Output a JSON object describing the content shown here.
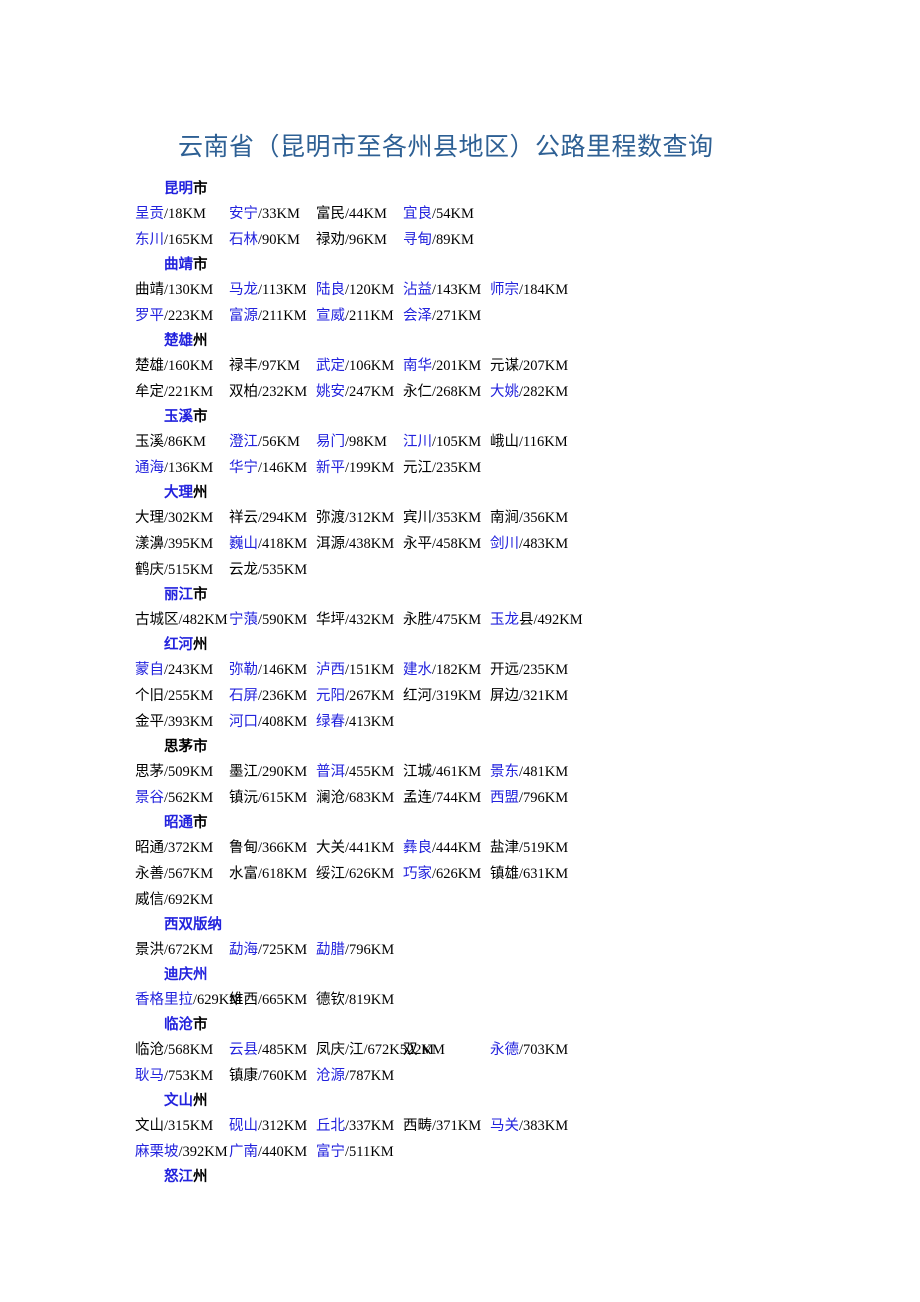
{
  "title": "云南省（昆明市至各州县地区）公路里程数查询",
  "colors": {
    "title": "#2e6094",
    "link_blue": "#2222dd",
    "text_black": "#000000",
    "background": "#ffffff"
  },
  "sections": [
    {
      "header": {
        "blue": "昆明",
        "black": "市"
      },
      "rows": [
        [
          {
            "name": "呈贡",
            "color": "blue",
            "dist": "18KM"
          },
          {
            "name": "安宁",
            "color": "blue",
            "dist": "33KM"
          },
          {
            "name": "富民",
            "color": "black",
            "dist": "44KM"
          },
          {
            "name": "宜良",
            "color": "blue",
            "dist": "54KM"
          }
        ],
        [
          {
            "name": "东川",
            "color": "blue",
            "dist": "165KM"
          },
          {
            "name": "石林",
            "color": "blue",
            "dist": "90KM"
          },
          {
            "name": "禄劝",
            "color": "black",
            "dist": "96KM"
          },
          {
            "name": "寻甸",
            "color": "blue",
            "dist": "89KM"
          }
        ]
      ]
    },
    {
      "header": {
        "blue": "曲靖",
        "black": "市"
      },
      "rows": [
        [
          {
            "name": "曲靖",
            "color": "black",
            "dist": "130KM"
          },
          {
            "name": "马龙",
            "color": "blue",
            "dist": "113KM"
          },
          {
            "name": "陆良",
            "color": "blue",
            "dist": "120KM"
          },
          {
            "name": "沾益",
            "color": "blue",
            "dist": "143KM"
          },
          {
            "name": "师宗",
            "color": "blue",
            "dist": "184KM"
          }
        ],
        [
          {
            "name": "罗平",
            "color": "blue",
            "dist": "223KM"
          },
          {
            "name": "富源",
            "color": "blue",
            "dist": "211KM"
          },
          {
            "name": "宣威",
            "color": "blue",
            "dist": "211KM"
          },
          {
            "name": "会泽",
            "color": "blue",
            "dist": "271KM"
          }
        ]
      ]
    },
    {
      "header": {
        "blue": "楚雄",
        "black": "州"
      },
      "rows": [
        [
          {
            "name": "楚雄",
            "color": "black",
            "dist": "160KM"
          },
          {
            "name": "禄丰",
            "color": "black",
            "dist": "97KM"
          },
          {
            "name": "武定",
            "color": "blue",
            "dist": "106KM"
          },
          {
            "name": "南华",
            "color": "blue",
            "dist": "201KM"
          },
          {
            "name": "元谋",
            "color": "black",
            "dist": "207KM"
          }
        ],
        [
          {
            "name": "牟定",
            "color": "black",
            "dist": "221KM"
          },
          {
            "name": "双柏",
            "color": "black",
            "dist": "232KM"
          },
          {
            "name": "姚安",
            "color": "blue",
            "dist": "247KM"
          },
          {
            "name": "永仁",
            "color": "black",
            "dist": "268KM"
          },
          {
            "name": "大姚",
            "color": "blue",
            "dist": "282KM"
          }
        ]
      ]
    },
    {
      "header": {
        "blue": "玉溪",
        "black": "市"
      },
      "rows": [
        [
          {
            "name": "玉溪",
            "color": "black",
            "dist": "86KM"
          },
          {
            "name": "澄江",
            "color": "blue",
            "dist": "56KM"
          },
          {
            "name": "易门",
            "color": "blue",
            "dist": "98KM"
          },
          {
            "name": "江川",
            "color": "blue",
            "dist": "105KM"
          },
          {
            "name": "峨山",
            "color": "black",
            "dist": "116KM"
          }
        ],
        [
          {
            "name": "通海",
            "color": "blue",
            "dist": "136KM"
          },
          {
            "name": "华宁",
            "color": "blue",
            "dist": "146KM"
          },
          {
            "name": "新平",
            "color": "blue",
            "dist": "199KM"
          },
          {
            "name": "元江",
            "color": "black",
            "dist": "235KM"
          }
        ]
      ]
    },
    {
      "header": {
        "blue": "大理",
        "black": "州"
      },
      "rows": [
        [
          {
            "name": "大理",
            "color": "black",
            "dist": "302KM"
          },
          {
            "name": "祥云",
            "color": "black",
            "dist": "294KM"
          },
          {
            "name": "弥渡",
            "color": "black",
            "dist": "312KM"
          },
          {
            "name": "宾川",
            "color": "black",
            "dist": "353KM"
          },
          {
            "name": "南涧",
            "color": "black",
            "dist": "356KM"
          }
        ],
        [
          {
            "name": "漾濞",
            "color": "black",
            "dist": "395KM"
          },
          {
            "name": "巍山",
            "color": "blue",
            "dist": "418KM"
          },
          {
            "name": "洱源",
            "color": "black",
            "dist": "438KM"
          },
          {
            "name": "永平",
            "color": "black",
            "dist": "458KM"
          },
          {
            "name": "剑川",
            "color": "blue",
            "dist": "483KM"
          }
        ],
        [
          {
            "name": "鹤庆",
            "color": "black",
            "dist": "515KM"
          },
          {
            "name": "云龙",
            "color": "black",
            "dist": "535KM"
          }
        ]
      ]
    },
    {
      "header": {
        "blue": "丽江",
        "black": "市"
      },
      "rows": [
        [
          {
            "name": "古城区",
            "color": "black",
            "dist": "482KM"
          },
          {
            "name": "宁蒗",
            "color": "blue",
            "dist": "590KM"
          },
          {
            "name": "华坪",
            "color": "black",
            "dist": "432KM"
          },
          {
            "name": "永胜",
            "color": "black",
            "dist": "475KM"
          },
          {
            "name": "玉龙县",
            "color": "blue_partial",
            "name_blue": "玉龙",
            "name_black": "县",
            "dist": "492KM"
          }
        ]
      ]
    },
    {
      "header": {
        "blue": "红河",
        "black": "州"
      },
      "rows": [
        [
          {
            "name": "蒙自",
            "color": "blue",
            "dist": "243KM"
          },
          {
            "name": "弥勒",
            "color": "blue",
            "dist": "146KM"
          },
          {
            "name": "泸西",
            "color": "blue",
            "dist": "151KM"
          },
          {
            "name": "建水",
            "color": "blue",
            "dist": "182KM"
          },
          {
            "name": "开远",
            "color": "black",
            "dist": "235KM"
          }
        ],
        [
          {
            "name": "个旧",
            "color": "black",
            "dist": "255KM"
          },
          {
            "name": "石屏",
            "color": "blue",
            "dist": "236KM"
          },
          {
            "name": "元阳",
            "color": "blue",
            "dist": "267KM"
          },
          {
            "name": "红河",
            "color": "black",
            "dist": "319KM"
          },
          {
            "name": "屏边",
            "color": "black",
            "dist": "321KM"
          }
        ],
        [
          {
            "name": "金平",
            "color": "black",
            "dist": "393KM"
          },
          {
            "name": "河口",
            "color": "blue",
            "dist": "408KM"
          },
          {
            "name": "绿春",
            "color": "blue",
            "dist": "413KM"
          }
        ]
      ]
    },
    {
      "header": {
        "blue": "",
        "black": "思茅市"
      },
      "rows": [
        [
          {
            "name": "思茅",
            "color": "black",
            "dist": "509KM"
          },
          {
            "name": "墨江",
            "color": "black",
            "dist": "290KM"
          },
          {
            "name": "普洱",
            "color": "blue",
            "dist": "455KM"
          },
          {
            "name": "江城",
            "color": "black",
            "dist": "461KM"
          },
          {
            "name": "景东",
            "color": "blue",
            "dist": "481KM"
          }
        ],
        [
          {
            "name": "景谷",
            "color": "blue",
            "dist": "562KM"
          },
          {
            "name": "镇沅",
            "color": "black",
            "dist": "615KM"
          },
          {
            "name": "澜沧",
            "color": "black",
            "dist": "683KM"
          },
          {
            "name": "孟连",
            "color": "black",
            "dist": "744KM"
          },
          {
            "name": "西盟",
            "color": "blue",
            "dist": "796KM"
          }
        ]
      ]
    },
    {
      "header": {
        "blue": "昭通",
        "black": "市"
      },
      "rows": [
        [
          {
            "name": "昭通",
            "color": "black",
            "dist": "372KM"
          },
          {
            "name": "鲁甸",
            "color": "black",
            "dist": "366KM"
          },
          {
            "name": "大关",
            "color": "black",
            "dist": "441KM"
          },
          {
            "name": "彝良",
            "color": "blue",
            "dist": "444KM"
          },
          {
            "name": "盐津",
            "color": "black",
            "dist": "519KM"
          }
        ],
        [
          {
            "name": "永善",
            "color": "black",
            "dist": "567KM"
          },
          {
            "name": "水富",
            "color": "black",
            "dist": "618KM"
          },
          {
            "name": "绥江",
            "color": "black",
            "dist": "626KM"
          },
          {
            "name": "巧家",
            "color": "blue",
            "dist": "626KM"
          },
          {
            "name": "镇雄",
            "color": "black",
            "dist": "631KM"
          }
        ],
        [
          {
            "name": "威信",
            "color": "black",
            "dist": "692KM"
          }
        ]
      ]
    },
    {
      "header": {
        "blue": "西双版纳",
        "black": ""
      },
      "rows": [
        [
          {
            "name": "景洪",
            "color": "black",
            "dist": "672KM"
          },
          {
            "name": "勐海",
            "color": "blue",
            "dist": "725KM"
          },
          {
            "name": "勐腊",
            "color": "blue",
            "dist": "796KM"
          }
        ]
      ]
    },
    {
      "header": {
        "blue": "迪庆州",
        "black": ""
      },
      "rows": [
        [
          {
            "name": "香格里拉",
            "color": "blue",
            "dist": "629KM"
          },
          {
            "name": "维西",
            "color": "black",
            "dist": "665KM"
          },
          {
            "name": "德钦",
            "color": "black",
            "dist": "819KM"
          }
        ]
      ]
    },
    {
      "header": {
        "blue": "临沧",
        "black": "市"
      },
      "rows": [
        [
          {
            "name": "临沧",
            "color": "black",
            "dist": "568KM"
          },
          {
            "name": "云县",
            "color": "blue",
            "dist": "485KM"
          },
          {
            "name": "凤庆",
            "color": "black",
            "dist": "江/672K522KM"
          },
          {
            "name": "双",
            "color": "black",
            "dist": "M",
            "raw": "双 M"
          },
          {
            "name": "永德",
            "color": "blue",
            "dist": "703KM"
          }
        ],
        [
          {
            "name": "耿马",
            "color": "blue",
            "dist": "753KM"
          },
          {
            "name": "镇康",
            "color": "black",
            "dist": "760KM"
          },
          {
            "name": "沧源",
            "color": "blue",
            "dist": "787KM"
          }
        ]
      ]
    },
    {
      "header": {
        "blue": "文山",
        "black": "州"
      },
      "rows": [
        [
          {
            "name": "文山",
            "color": "black",
            "dist": "315KM"
          },
          {
            "name": "砚山",
            "color": "blue",
            "dist": "312KM"
          },
          {
            "name": "丘北",
            "color": "blue",
            "dist": "337KM"
          },
          {
            "name": "西畴",
            "color": "black",
            "dist": "371KM"
          },
          {
            "name": "马关",
            "color": "blue",
            "dist": "383KM"
          }
        ],
        [
          {
            "name": "麻栗坡",
            "color": "blue",
            "dist": "392KM"
          },
          {
            "name": "广南",
            "color": "blue",
            "dist": "440KM"
          },
          {
            "name": "富宁",
            "color": "blue",
            "dist": "511KM"
          }
        ]
      ]
    },
    {
      "header": {
        "blue": "怒江",
        "black": "州"
      },
      "rows": []
    }
  ]
}
